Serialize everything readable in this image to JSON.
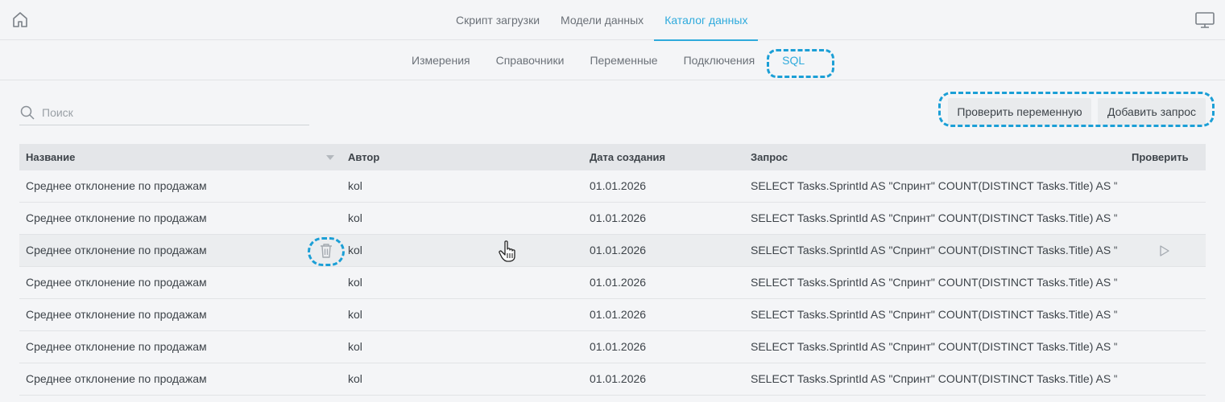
{
  "nav": {
    "tabs": [
      "Скрипт загрузки",
      "Модели данных",
      "Каталог данных"
    ],
    "active_tab": 2
  },
  "subnav": {
    "tabs": [
      "Измерения",
      "Справочники",
      "Переменные",
      "Подключения",
      "SQL"
    ],
    "active_tab": 4
  },
  "search": {
    "placeholder": "Поиск",
    "value": ""
  },
  "actions": {
    "check_variable_label": "Проверить переменную",
    "add_query_label": "Добавить запрос"
  },
  "table": {
    "columns": {
      "name": "Название",
      "author": "Автор",
      "date": "Дата создания",
      "query": "Запрос",
      "check": "Проверить"
    },
    "rows": [
      {
        "name": "Среднее отклонение по продажам",
        "author": "kol",
        "date": "01.01.2026",
        "query": "SELECT Tasks.SprintId AS \"Спринт\" COUNT(DISTINCT Tasks.Title) AS \"..."
      },
      {
        "name": "Среднее отклонение по продажам",
        "author": "kol",
        "date": "01.01.2026",
        "query": "SELECT Tasks.SprintId AS \"Спринт\" COUNT(DISTINCT Tasks.Title) AS \"..."
      },
      {
        "name": "Среднее отклонение по продажам",
        "author": "kol",
        "date": "01.01.2026",
        "query": "SELECT Tasks.SprintId AS \"Спринт\" COUNT(DISTINCT Tasks.Title) AS \"..."
      },
      {
        "name": "Среднее отклонение по продажам",
        "author": "kol",
        "date": "01.01.2026",
        "query": "SELECT Tasks.SprintId AS \"Спринт\" COUNT(DISTINCT Tasks.Title) AS \"..."
      },
      {
        "name": "Среднее отклонение по продажам",
        "author": "kol",
        "date": "01.01.2026",
        "query": "SELECT Tasks.SprintId AS \"Спринт\" COUNT(DISTINCT Tasks.Title) AS \"..."
      },
      {
        "name": "Среднее отклонение по продажам",
        "author": "kol",
        "date": "01.01.2026",
        "query": "SELECT Tasks.SprintId AS \"Спринт\" COUNT(DISTINCT Tasks.Title) AS \"..."
      },
      {
        "name": "Среднее отклонение по продажам",
        "author": "kol",
        "date": "01.01.2026",
        "query": "SELECT Tasks.SprintId AS \"Спринт\" COUNT(DISTINCT Tasks.Title) AS \"..."
      }
    ],
    "hovered_row": 2
  },
  "colors": {
    "accent": "#2eaadc",
    "highlight": "#1b9fd6",
    "background": "#f4f5f7"
  }
}
